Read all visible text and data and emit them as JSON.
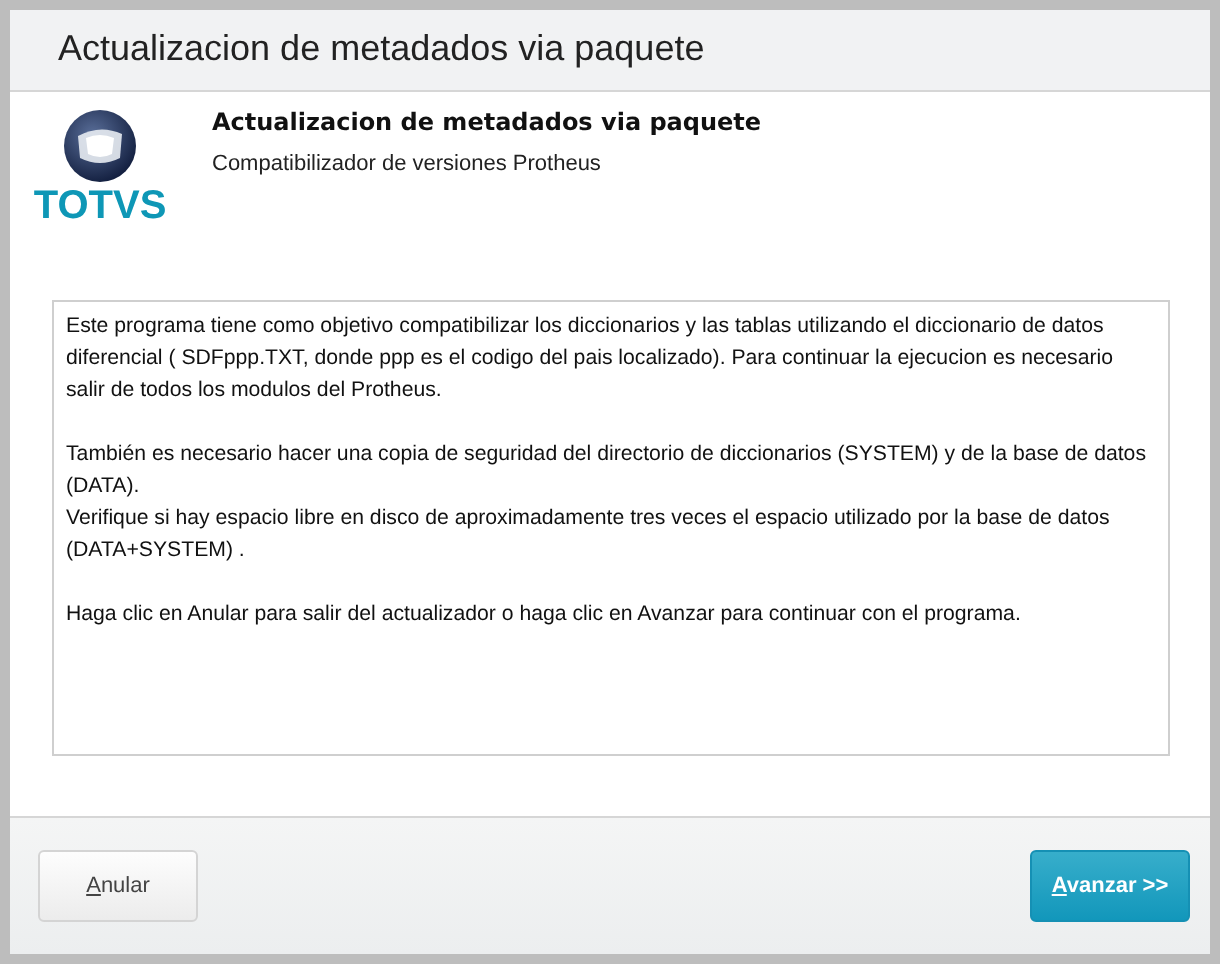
{
  "window": {
    "title": "Actualizacion de metadados via paquete"
  },
  "header": {
    "title": "Actualizacion de metadados via paquete",
    "subtitle": "Compatibilizador de versiones Protheus",
    "logo_text": "TOTVS"
  },
  "message": [
    [
      "Este programa tiene como objetivo compatibilizar los diccionarios y las tablas utilizando el diccionario de datos diferencial ( SDFppp.TXT, donde ppp es el codigo del pais localizado).   Para continuar la ejecucion es necesario salir de todos los modulos del Protheus."
    ],
    [
      "También es necesario hacer una copia de seguridad del directorio de diccionarios (SYSTEM) y de la base de datos (DATA).",
      "Verifique si hay espacio libre en disco de aproximadamente tres veces el espacio utilizado por la base de datos (DATA+SYSTEM) ."
    ],
    [
      "Haga clic en Anular para salir del actualizador o haga clic en Avanzar para continuar con el programa."
    ]
  ],
  "buttons": [
    {
      "label": "Anular",
      "kind": "secondary"
    },
    {
      "label": "Avanzar >>",
      "kind": "primary"
    }
  ]
}
